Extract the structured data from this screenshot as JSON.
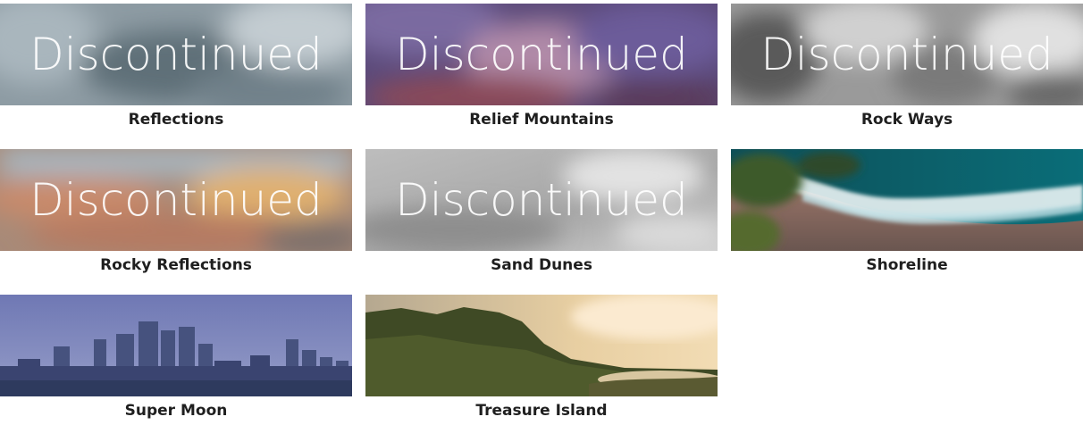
{
  "overlay_text": "Discontinued",
  "items": [
    {
      "name": "Reflections",
      "discontinued": true
    },
    {
      "name": "Relief Mountains",
      "discontinued": true
    },
    {
      "name": "Rock Ways",
      "discontinued": true
    },
    {
      "name": "Rocky Reflections",
      "discontinued": true
    },
    {
      "name": "Sand Dunes",
      "discontinued": true
    },
    {
      "name": "Shoreline",
      "discontinued": false
    },
    {
      "name": "Super Moon",
      "discontinued": false
    },
    {
      "name": "Treasure Island",
      "discontinued": false
    }
  ]
}
